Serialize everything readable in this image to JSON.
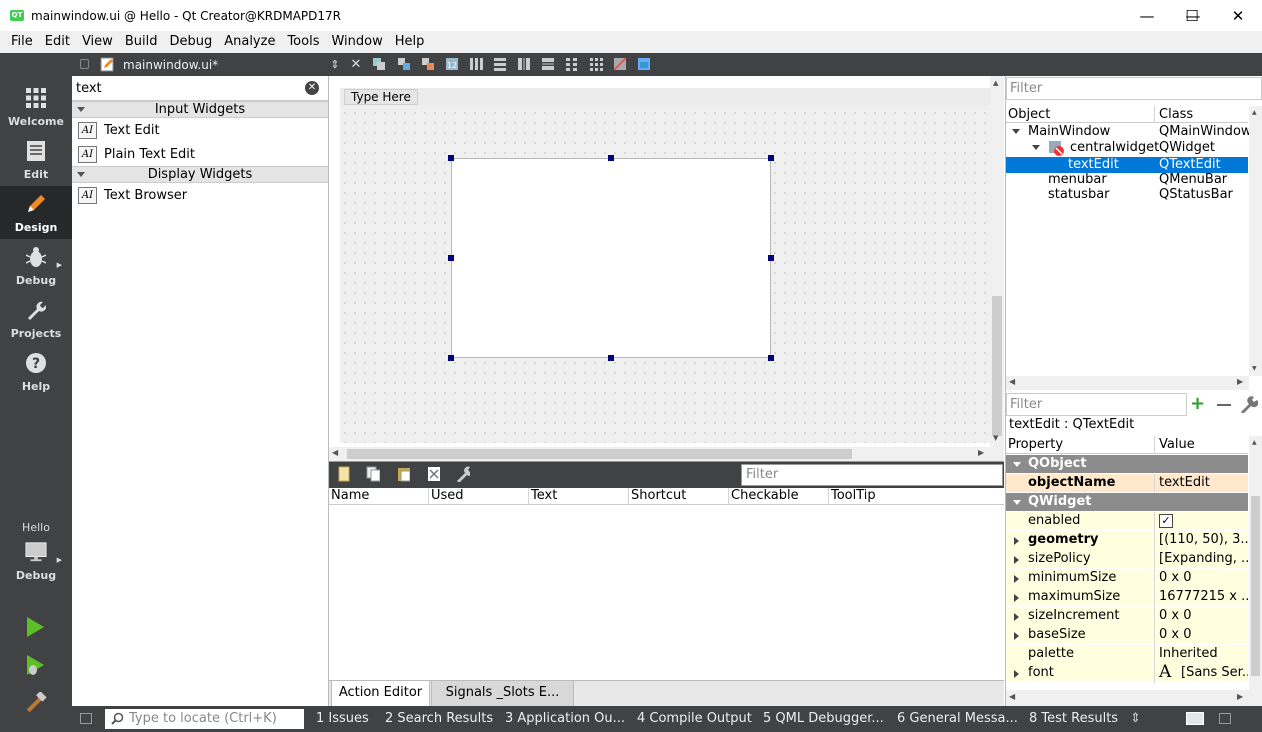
{
  "window": {
    "title": "mainwindow.ui @ Hello - Qt Creator@KRDMAPD17R",
    "logo_text": "QT",
    "minimize_glyph": "—",
    "maximize_glyph": "☐",
    "close_glyph": "✕"
  },
  "menubar": [
    "File",
    "Edit",
    "View",
    "Build",
    "Debug",
    "Analyze",
    "Tools",
    "Window",
    "Help"
  ],
  "modes": [
    {
      "label": "Welcome",
      "icon": "welcome-grid-icon"
    },
    {
      "label": "Edit",
      "icon": "edit-document-icon"
    },
    {
      "label": "Design",
      "icon": "design-pencil-icon",
      "active": true
    },
    {
      "label": "Debug",
      "icon": "debug-bug-icon"
    },
    {
      "label": "Projects",
      "icon": "projects-wrench-icon"
    },
    {
      "label": "Help",
      "icon": "help-question-icon"
    }
  ],
  "kit": {
    "project": "Hello",
    "config": "Debug"
  },
  "editor_tab": {
    "file": "mainwindow.ui*"
  },
  "widget_box": {
    "filter_value": "text",
    "categories": [
      {
        "name": "Input Widgets",
        "items": [
          "Text Edit",
          "Plain Text Edit"
        ]
      },
      {
        "name": "Display Widgets",
        "items": [
          "Text Browser"
        ]
      }
    ],
    "item_icon_text": "AI"
  },
  "form": {
    "type_here": "Type Here"
  },
  "action_editor": {
    "filter_placeholder": "Filter",
    "columns": [
      "Name",
      "Used",
      "Text",
      "Shortcut",
      "Checkable",
      "ToolTip"
    ],
    "tabs": [
      "Action Editor",
      "Signals _Slots E..."
    ]
  },
  "object_inspector": {
    "filter_placeholder": "Filter",
    "columns": [
      "Object",
      "Class"
    ],
    "rows": [
      {
        "object": "MainWindow",
        "class": "QMainWindow"
      },
      {
        "object": "centralwidget",
        "class": "QWidget"
      },
      {
        "object": "textEdit",
        "class": "QTextEdit",
        "selected": true
      },
      {
        "object": "menubar",
        "class": "QMenuBar"
      },
      {
        "object": "statusbar",
        "class": "QStatusBar"
      }
    ]
  },
  "property_editor": {
    "filter_placeholder": "Filter",
    "class_line": "textEdit : QTextEdit",
    "columns": [
      "Property",
      "Value"
    ],
    "groups": [
      {
        "name": "QObject",
        "props": [
          {
            "name": "objectName",
            "value": "textEdit",
            "bold": true
          }
        ]
      },
      {
        "name": "QWidget",
        "props": [
          {
            "name": "enabled",
            "value": "✓"
          },
          {
            "name": "geometry",
            "value": "[(110, 50), 3...",
            "bold": true
          },
          {
            "name": "sizePolicy",
            "value": "[Expanding, ..."
          },
          {
            "name": "minimumSize",
            "value": "0 x 0"
          },
          {
            "name": "maximumSize",
            "value": "16777215 x ..."
          },
          {
            "name": "sizeIncrement",
            "value": "0 x 0"
          },
          {
            "name": "baseSize",
            "value": "0 x 0"
          },
          {
            "name": "palette",
            "value": "Inherited"
          },
          {
            "name": "font",
            "value": "[Sans Ser...",
            "glyph": "A"
          }
        ]
      }
    ]
  },
  "statusbar": {
    "locator_placeholder": "Type to locate (Ctrl+K)",
    "panes": [
      "1  Issues",
      "2  Search Results",
      "3  Application Ou...",
      "4  Compile Output",
      "5  QML Debugger...",
      "6  General Messa...",
      "8  Test Results"
    ]
  },
  "colors": {
    "selection": "#0078d7",
    "mode_bar": "#404244",
    "property_yellow": "#ffffe0",
    "group_gray": "#8c8c8c"
  }
}
